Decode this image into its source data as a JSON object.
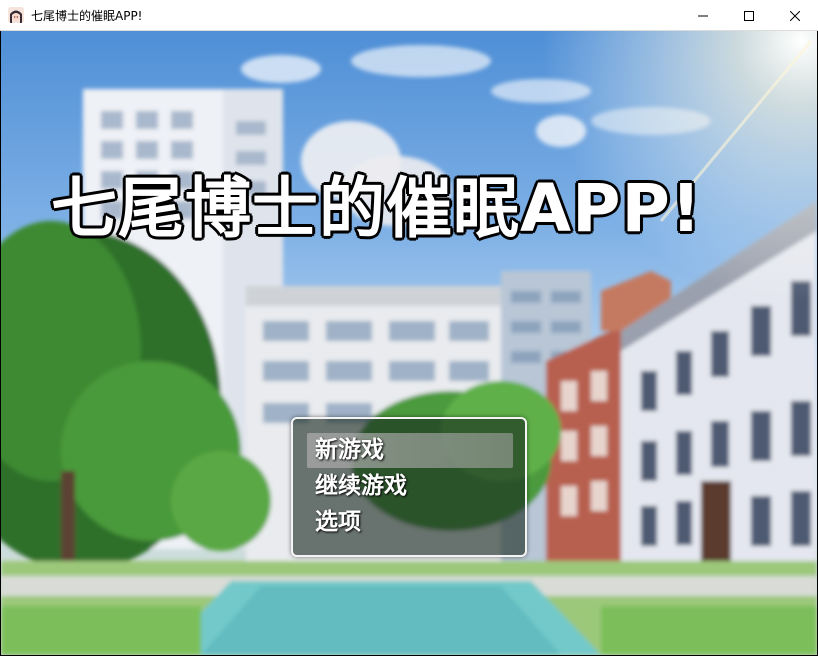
{
  "window": {
    "title": "七尾博士的催眠APP!",
    "icon": "app-character-icon",
    "buttons": [
      "minimize-icon",
      "maximize-icon",
      "close-icon"
    ]
  },
  "game": {
    "title": "七尾博士的催眠APP!",
    "menu": {
      "items": [
        {
          "label": "新游戏",
          "selected": true
        },
        {
          "label": "继续游戏",
          "selected": false
        },
        {
          "label": "选项",
          "selected": false
        }
      ]
    }
  }
}
